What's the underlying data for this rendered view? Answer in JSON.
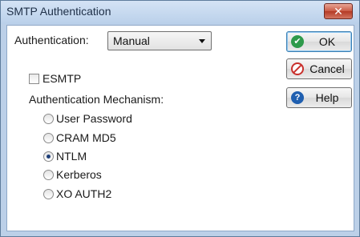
{
  "window": {
    "title": "SMTP Authentication",
    "close_glyph": "✕"
  },
  "authentication": {
    "label": "Authentication:",
    "selected": "Manual"
  },
  "esmtp": {
    "label": "ESMTP",
    "checked": false
  },
  "mechanism": {
    "label": "Authentication Mechanism:",
    "options": [
      {
        "label": "User Password",
        "checked": false
      },
      {
        "label": "CRAM MD5",
        "checked": false
      },
      {
        "label": "NTLM",
        "checked": true
      },
      {
        "label": "Kerberos",
        "checked": false
      },
      {
        "label": "XO AUTH2",
        "checked": false
      }
    ]
  },
  "buttons": {
    "ok": {
      "label": "OK",
      "icon": "check-icon",
      "icon_glyph": "✔"
    },
    "cancel": {
      "label": "Cancel",
      "icon": "prohibited-icon"
    },
    "help": {
      "label": "Help",
      "icon": "question-icon",
      "icon_glyph": "?"
    }
  },
  "colors": {
    "ok_icon": "#2e9a4b",
    "cancel_icon": "#c9302c",
    "help_icon": "#1f5fb0",
    "title_bar": "#c6d9f0"
  }
}
